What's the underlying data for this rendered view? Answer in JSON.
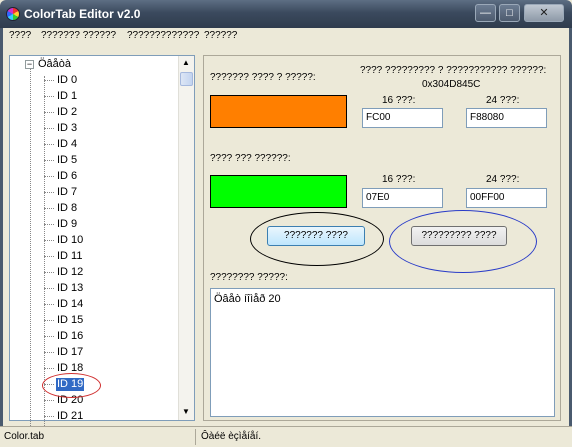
{
  "window": {
    "title": "ColorTab Editor v2.0",
    "controls": {
      "minimize": "—",
      "maximize": "□",
      "close": "✕"
    }
  },
  "menu": [
    "????",
    "??????? ??????",
    "?????????????",
    "??????"
  ],
  "tree": {
    "root_label": "Öâåòà",
    "expander": "−",
    "items": [
      "ID 0",
      "ID 1",
      "ID 2",
      "ID 3",
      "ID 4",
      "ID 5",
      "ID 6",
      "ID 7",
      "ID 8",
      "ID 9",
      "ID 10",
      "ID 11",
      "ID 12",
      "ID 13",
      "ID 14",
      "ID 15",
      "ID 16",
      "ID 17",
      "ID 18",
      "ID 19",
      "ID 20",
      "ID 21"
    ],
    "selected": "ID 19",
    "scroll_up": "▲",
    "scroll_down": "▼"
  },
  "editor": {
    "color1_label": "??????? ???? ? ?????:",
    "header_label": "???? ????????? ? ??????????? ??????:",
    "address": "0x304D845C",
    "color1": {
      "hex": "#ff7f00",
      "f16_label": "16 ???:",
      "f16_value": "FC00",
      "f24_label": "24 ???:",
      "f24_value": "F88080"
    },
    "color2_label": "???? ??? ??????:",
    "color2": {
      "hex": "#00ff00",
      "f16_label": "16 ???:",
      "f16_value": "07E0",
      "f24_label": "24 ???:",
      "f24_value": "00FF00"
    },
    "button_primary": "??????? ????",
    "button_secondary": "????????? ????",
    "notes_label": "???????? ?????:",
    "notes_text": "Öâåò íîìåð 20",
    "highlight_black": "#000000",
    "highlight_blue": "#2a3cc8",
    "highlight_red": "#d03030"
  },
  "status": {
    "file": "Color.tab",
    "message": "Ôàéë èçìåíåí."
  }
}
